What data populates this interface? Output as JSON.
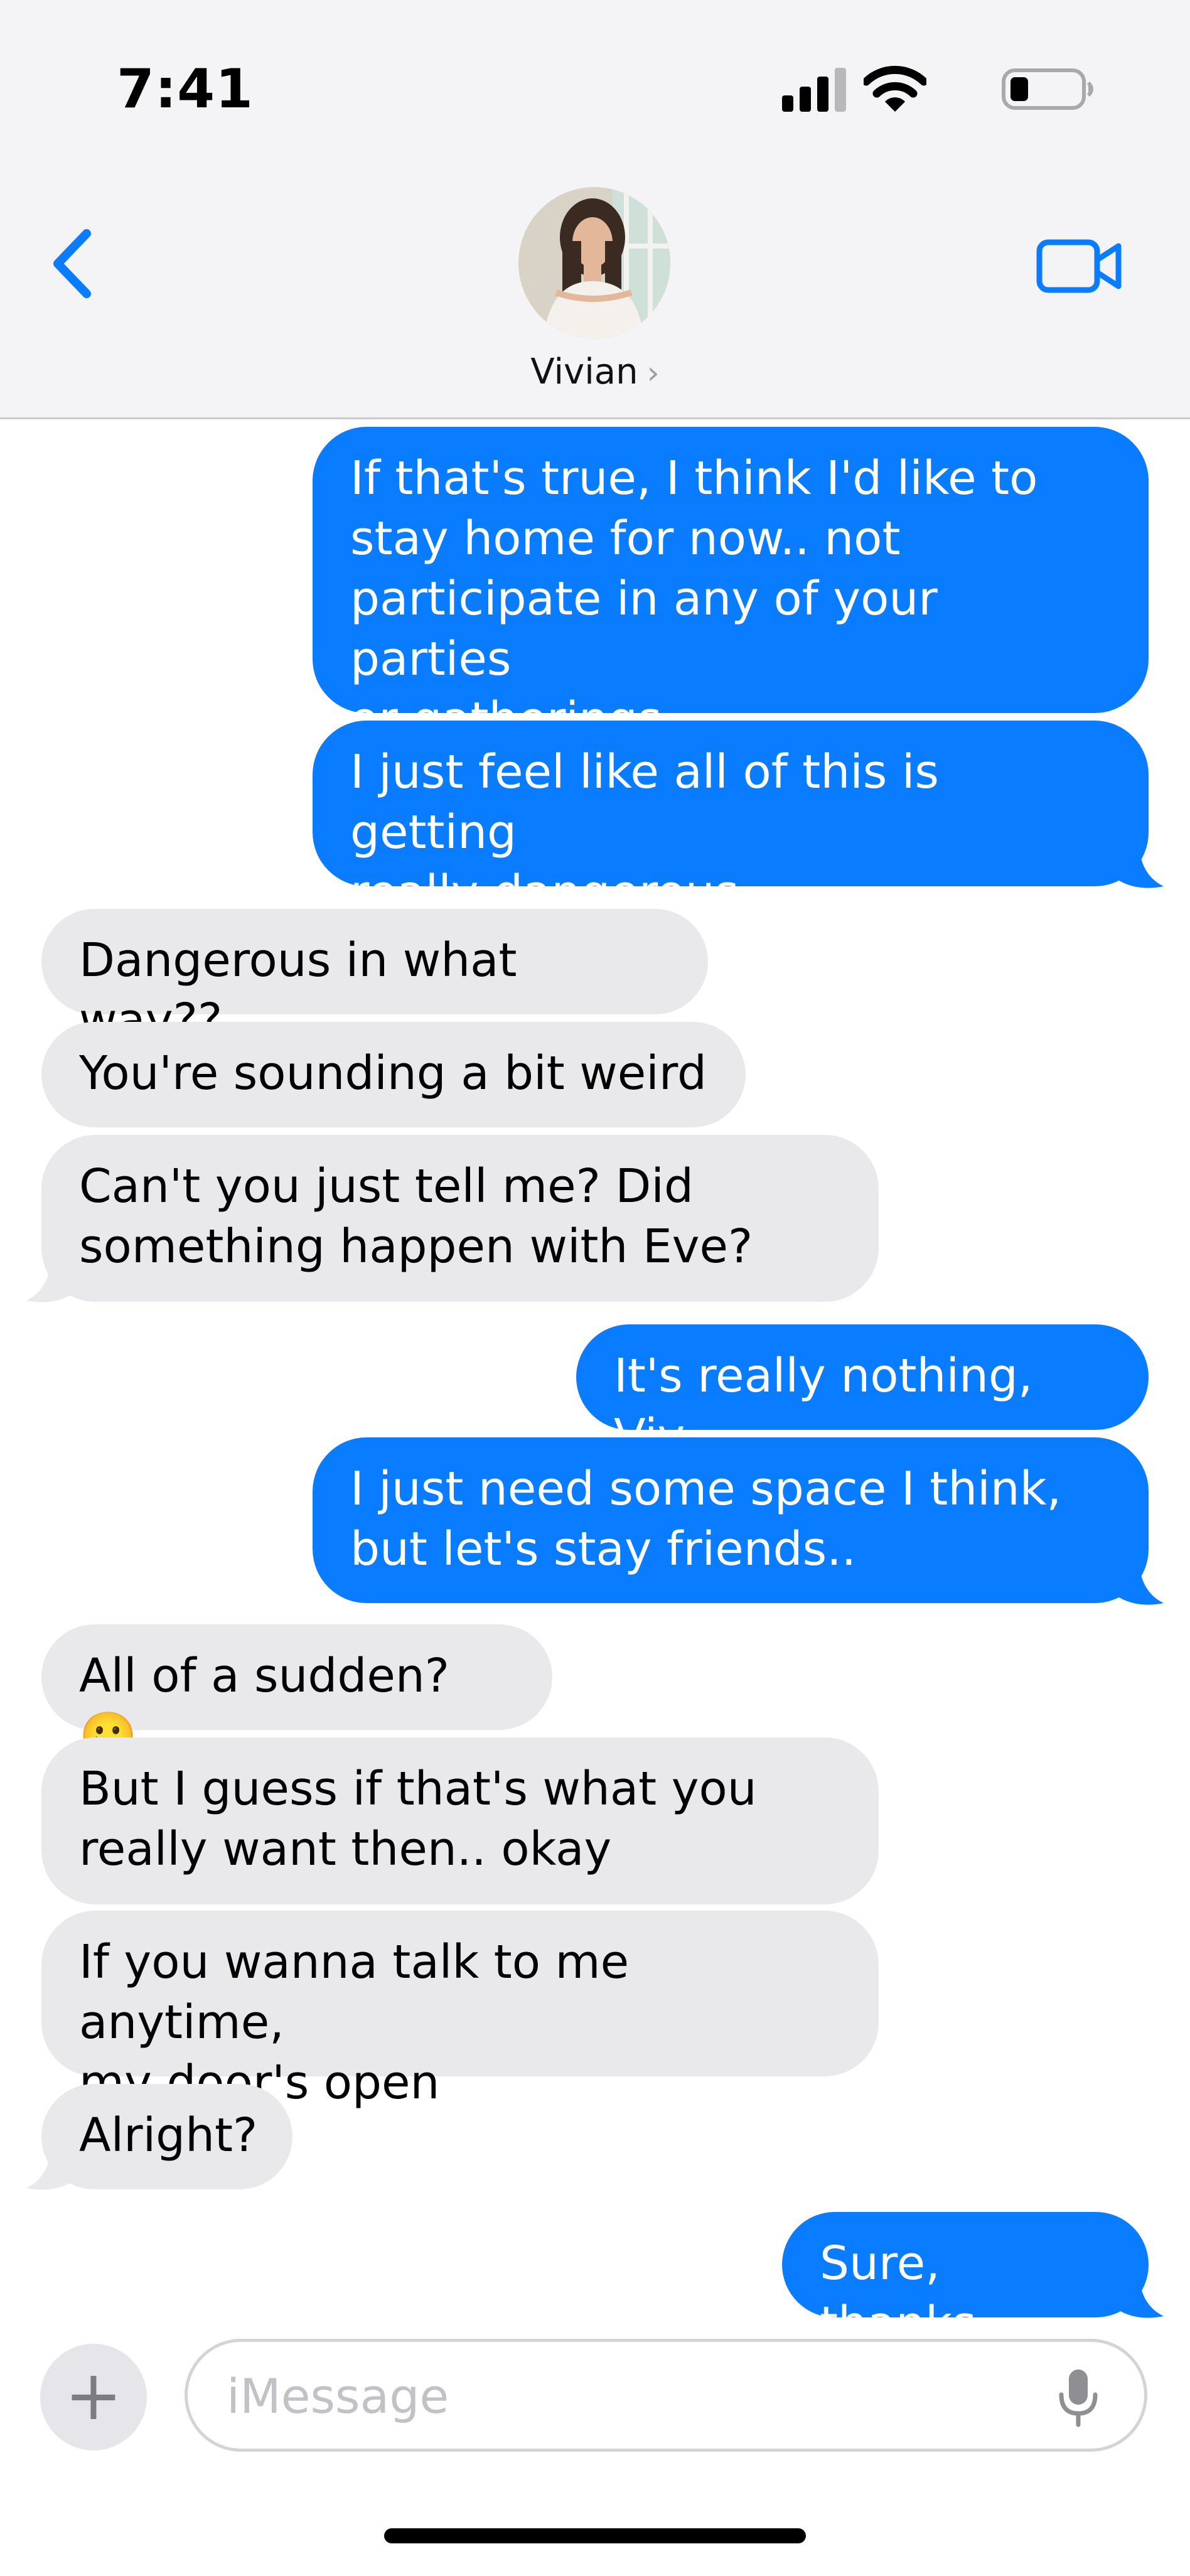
{
  "status_bar": {
    "time": "7:41"
  },
  "header": {
    "contact_name": "Vivian",
    "chevron": "›"
  },
  "messages": [
    {
      "dir": "out",
      "lines": [
        "If that's true, I think I'd like to",
        "stay home for now.. not",
        "participate in any of your parties",
        "or gatherings"
      ]
    },
    {
      "dir": "out",
      "lines": [
        "I just feel like all of this is getting",
        "really dangerous.."
      ]
    },
    {
      "dir": "in",
      "lines": [
        "Dangerous in what way??"
      ]
    },
    {
      "dir": "in",
      "lines": [
        "You're sounding a bit weird"
      ]
    },
    {
      "dir": "in",
      "lines": [
        "Can't you just tell me? Did",
        "something happen with Eve?"
      ]
    },
    {
      "dir": "out",
      "lines": [
        "It's really nothing, Viv"
      ]
    },
    {
      "dir": "out",
      "lines": [
        "I just need some space I think,",
        "but let's stay friends.."
      ]
    },
    {
      "dir": "in",
      "lines": [
        "All of a sudden? 🥲"
      ]
    },
    {
      "dir": "in",
      "lines": [
        "But I guess if that's what you",
        "really want then.. okay"
      ]
    },
    {
      "dir": "in",
      "lines": [
        "If you wanna talk to me anytime,",
        "my door's open"
      ]
    },
    {
      "dir": "in",
      "lines": [
        "Alright?"
      ]
    },
    {
      "dir": "out",
      "lines": [
        "Sure, thanks"
      ]
    }
  ],
  "composer": {
    "plus": "+",
    "placeholder": "iMessage"
  },
  "colors": {
    "outgoing": "#0a7cff",
    "incoming": "#e9e9eb",
    "accent": "#0a7cff"
  }
}
